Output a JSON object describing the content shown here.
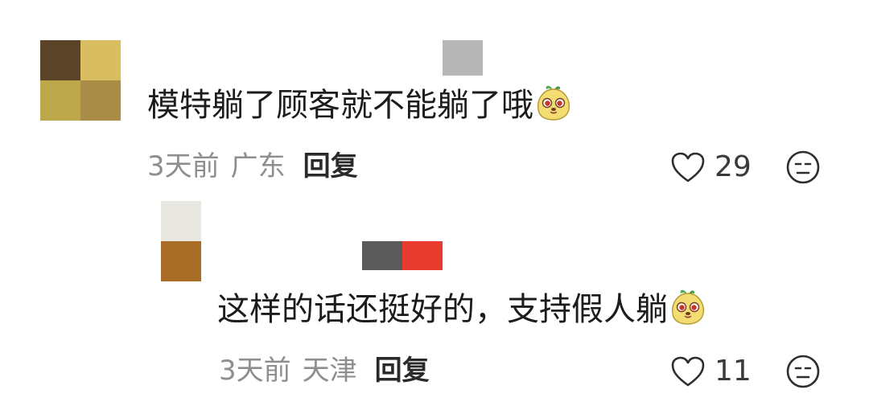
{
  "colors": {
    "text": "#1c1c1c",
    "meta": "#8e8e8e",
    "reply": "#2a2a2a",
    "accent_red": "#e63b2e"
  },
  "comments": [
    {
      "avatar_colors": [
        "#5a4327",
        "#d8be61",
        "#bca84b",
        "#a98c45"
      ],
      "text": "模特躺了顾客就不能躺了哦",
      "emoji_icon": "cartoon-fruit-emoji",
      "time": "3天前",
      "location": "广东",
      "reply_label": "回复",
      "likes": "29",
      "like_icon": "heart-outline-icon",
      "react_icon": "neutral-face-icon"
    },
    {
      "avatar_colors": [
        "#e9e7e2",
        "#a96d28"
      ],
      "text": "这样的话还挺好的，支持假人躺",
      "emoji_icon": "cartoon-fruit-emoji",
      "time": "3天前",
      "location": "天津",
      "reply_label": "回复",
      "likes": "11",
      "like_icon": "heart-outline-icon",
      "react_icon": "neutral-face-icon"
    }
  ]
}
